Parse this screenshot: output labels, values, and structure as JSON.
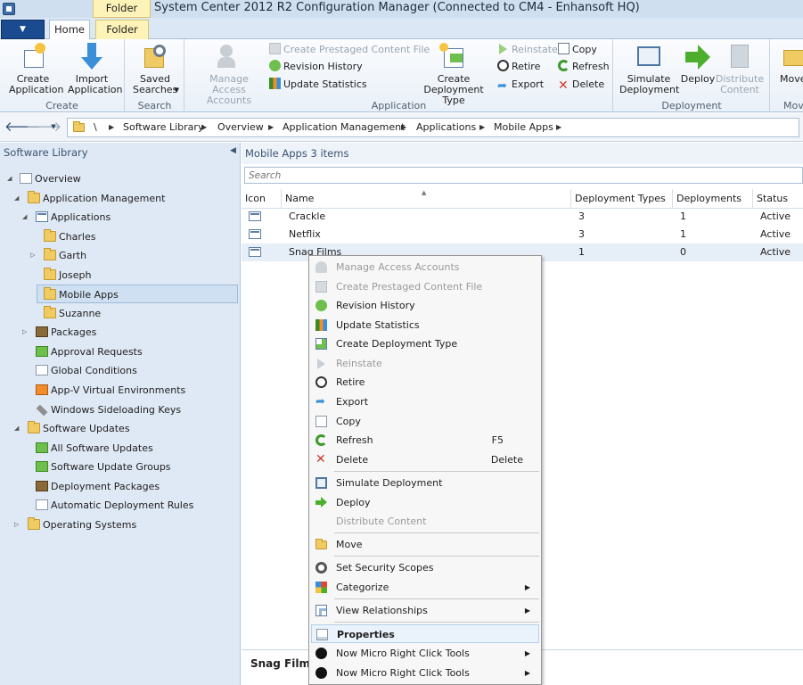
{
  "window": {
    "title": "System Center 2012 R2 Configuration Manager (Connected to CM4 - Enhansoft HQ)",
    "contextual_tab_group": "Folder Tools"
  },
  "ribbon": {
    "tabs": [
      "Home",
      "Folder"
    ],
    "groups": {
      "create": {
        "label": "Create",
        "create_application": "Create Application",
        "import_application": "Import Application"
      },
      "search": {
        "label": "Search",
        "saved_searches": "Saved Searches"
      },
      "application": {
        "label": "Application",
        "manage_access_accounts": "Manage Access Accounts",
        "create_prestaged": "Create Prestaged Content File",
        "revision_history": "Revision History",
        "update_statistics": "Update Statistics",
        "create_deployment_type": "Create Deployment Type",
        "reinstate": "Reinstate",
        "retire": "Retire",
        "export": "Export",
        "copy": "Copy",
        "refresh": "Refresh",
        "delete": "Delete"
      },
      "deployment": {
        "label": "Deployment",
        "simulate_deployment": "Simulate Deployment",
        "deploy": "Deploy",
        "distribute_content": "Distribute Content"
      },
      "move": {
        "label": "Move",
        "move": "Move"
      }
    }
  },
  "breadcrumb": {
    "root": "\\",
    "items": [
      "Software Library",
      "Overview",
      "Application Management",
      "Applications",
      "Mobile Apps"
    ]
  },
  "nav": {
    "title": "Software Library",
    "tree": [
      {
        "label": "Overview",
        "icon": "overview-icon"
      },
      {
        "label": "Application Management",
        "icon": "folder-icon"
      },
      {
        "label": "Applications",
        "icon": "applications-icon"
      },
      {
        "label": "Charles",
        "icon": "folder-icon"
      },
      {
        "label": "Garth",
        "icon": "folder-icon"
      },
      {
        "label": "Joseph",
        "icon": "folder-icon"
      },
      {
        "label": "Mobile Apps",
        "icon": "folder-icon"
      },
      {
        "label": "Suzanne",
        "icon": "folder-icon"
      },
      {
        "label": "Packages",
        "icon": "package-icon"
      },
      {
        "label": "Approval Requests",
        "icon": "approval-icon"
      },
      {
        "label": "Global Conditions",
        "icon": "conditions-icon"
      },
      {
        "label": "App-V Virtual Environments",
        "icon": "appv-icon"
      },
      {
        "label": "Windows Sideloading Keys",
        "icon": "key-icon"
      },
      {
        "label": "Software Updates",
        "icon": "folder-icon"
      },
      {
        "label": "All Software Updates",
        "icon": "updates-icon"
      },
      {
        "label": "Software Update Groups",
        "icon": "update-groups-icon"
      },
      {
        "label": "Deployment Packages",
        "icon": "package-icon"
      },
      {
        "label": "Automatic Deployment Rules",
        "icon": "rules-icon"
      },
      {
        "label": "Operating Systems",
        "icon": "folder-icon"
      }
    ]
  },
  "content": {
    "title": "Mobile Apps 3 items",
    "search_placeholder": "Search",
    "columns": [
      "Icon",
      "Name",
      "Deployment Types",
      "Deployments",
      "Status"
    ],
    "rows": [
      {
        "name": "Crackle",
        "deployment_types": "3",
        "deployments": "1",
        "status": "Active"
      },
      {
        "name": "Netflix",
        "deployment_types": "3",
        "deployments": "1",
        "status": "Active"
      },
      {
        "name": "Snag Films",
        "deployment_types": "1",
        "deployments": "0",
        "status": "Active"
      }
    ],
    "details_title": "Snag Films"
  },
  "context_menu": {
    "items": [
      {
        "label": "Manage Access Accounts",
        "icon": "access-accounts-icon",
        "disabled": true
      },
      {
        "label": "Create Prestaged Content File",
        "icon": "prestaged-icon",
        "disabled": true
      },
      {
        "label": "Revision History",
        "icon": "revision-history-icon"
      },
      {
        "label": "Update Statistics",
        "icon": "update-statistics-icon"
      },
      {
        "label": "Create Deployment Type",
        "icon": "deployment-type-icon"
      },
      {
        "label": "Reinstate",
        "icon": "reinstate-icon",
        "disabled": true
      },
      {
        "label": "Retire",
        "icon": "retire-icon"
      },
      {
        "label": "Export",
        "icon": "export-icon"
      },
      {
        "label": "Copy",
        "icon": "copy-icon"
      },
      {
        "label": "Refresh",
        "icon": "refresh-icon",
        "shortcut": "F5"
      },
      {
        "label": "Delete",
        "icon": "delete-icon",
        "shortcut": "Delete"
      },
      {
        "label": "Simulate Deployment",
        "icon": "simulate-icon"
      },
      {
        "label": "Deploy",
        "icon": "deploy-icon"
      },
      {
        "label": "Distribute Content",
        "icon": "distribute-icon",
        "disabled": true
      },
      {
        "label": "Move",
        "icon": "move-icon"
      },
      {
        "label": "Set Security Scopes",
        "icon": "security-scopes-icon"
      },
      {
        "label": "Categorize",
        "icon": "categorize-icon"
      },
      {
        "label": "View Relationships",
        "icon": "relationships-icon"
      },
      {
        "label": "Properties",
        "icon": "properties-icon"
      },
      {
        "label": "Now Micro Right Click Tools",
        "icon": "now-micro-icon"
      },
      {
        "label": "Now Micro Right Click Tools",
        "icon": "now-micro-icon"
      }
    ]
  },
  "colors": {
    "ribbon_bg": "#e9f0f8",
    "nav_bg": "#dfe9f5",
    "folder_tools": "#fdf2b8",
    "app_button": "#1a4a8f"
  }
}
